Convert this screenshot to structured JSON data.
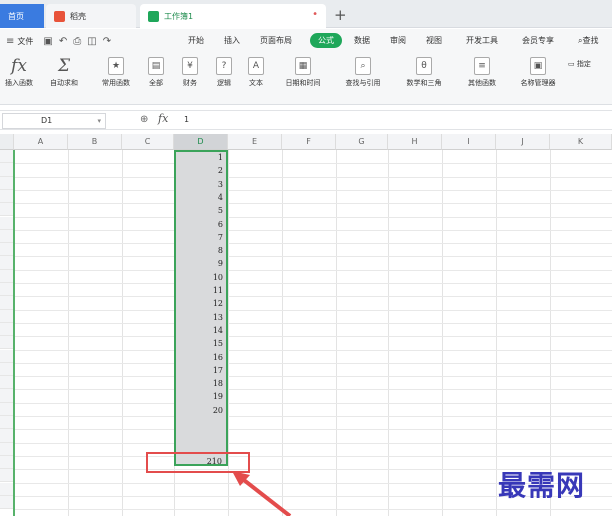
{
  "tabs": {
    "home": "首页",
    "doc": "稻壳",
    "book": "工作簿1"
  },
  "menu": {
    "file": "文件",
    "items": [
      "开始",
      "插入",
      "页面布局",
      "公式",
      "数据",
      "审阅",
      "视图",
      "开发工具",
      "会员专享"
    ],
    "search": "查找"
  },
  "ribbon": [
    {
      "label": "插入函数",
      "icon": "fx"
    },
    {
      "label": "自动求和",
      "icon": "Σ"
    },
    {
      "label": "常用函数",
      "icon": "★"
    },
    {
      "label": "全部",
      "icon": "▤"
    },
    {
      "label": "财务",
      "icon": "¥"
    },
    {
      "label": "逻辑",
      "icon": "?"
    },
    {
      "label": "文本",
      "icon": "A"
    },
    {
      "label": "日期和时间",
      "icon": "▦"
    },
    {
      "label": "查找与引用",
      "icon": "⌕"
    },
    {
      "label": "数学和三角",
      "icon": "θ"
    },
    {
      "label": "其他函数",
      "icon": "≡"
    },
    {
      "label": "名称管理器",
      "icon": "▣"
    },
    {
      "label": "指定",
      "icon": "▭"
    }
  ],
  "formula": {
    "cell_ref": "D1",
    "value": "1"
  },
  "columns": [
    "A",
    "B",
    "C",
    "D",
    "E",
    "F",
    "G",
    "H",
    "I",
    "J",
    "K"
  ],
  "selected_column": "D",
  "values": [
    "1",
    "2",
    "3",
    "4",
    "5",
    "6",
    "7",
    "8",
    "9",
    "10",
    "11",
    "12",
    "13",
    "14",
    "15",
    "16",
    "17",
    "18",
    "19",
    "20"
  ],
  "sum": "210",
  "watermark": "最需网",
  "colors": {
    "accent": "#1fa75a",
    "highlight": "#e34c4c"
  }
}
